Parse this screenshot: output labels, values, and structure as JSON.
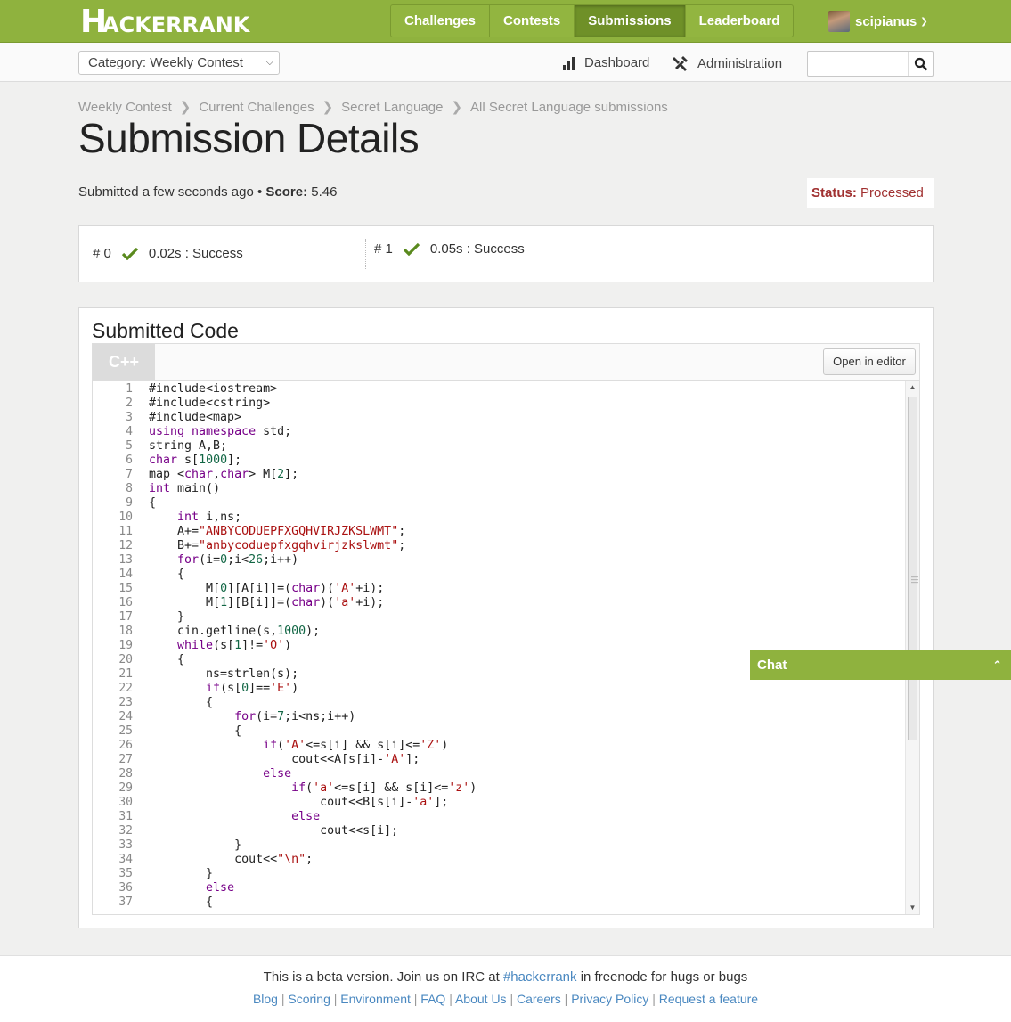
{
  "nav": {
    "logo": "HACKERRANK",
    "tabs": [
      "Challenges",
      "Contests",
      "Submissions",
      "Leaderboard"
    ],
    "active_tab": "Submissions",
    "username": "scipianus"
  },
  "subnav": {
    "category": "Category: Weekly Contest",
    "dashboard": "Dashboard",
    "administration": "Administration",
    "search_placeholder": ""
  },
  "breadcrumb": [
    "Weekly Contest",
    "Current Challenges",
    "Secret Language",
    "All Secret Language submissions"
  ],
  "page_title": "Submission Details",
  "meta": {
    "submitted": "Submitted a few seconds ago",
    "bullet": "•",
    "score_label": "Score:",
    "score_value": "5.46",
    "status_label": "Status:",
    "status_value": "Processed"
  },
  "tests": [
    {
      "id": "# 0",
      "result": "0.02s : Success"
    },
    {
      "id": "# 1",
      "result": "0.05s : Success"
    }
  ],
  "code": {
    "title": "Submitted Code",
    "language": "C++",
    "open_editor": "Open in editor",
    "lines": [
      "#include<iostream>",
      "#include<cstring>",
      "#include<map>",
      "using namespace std;",
      "string A,B;",
      "char s[1000];",
      "map <char,char> M[2];",
      "int main()",
      "{",
      "    int i,ns;",
      "    A+=\"ANBYCODUEPFXGQHVIRJZKSLWMT\";",
      "    B+=\"anbycoduepfxgqhvirjzkslwmt\";",
      "    for(i=0;i<26;i++)",
      "    {",
      "        M[0][A[i]]=(char)('A'+i);",
      "        M[1][B[i]]=(char)('a'+i);",
      "    }",
      "    cin.getline(s,1000);",
      "    while(s[1]!='O')",
      "    {",
      "        ns=strlen(s);",
      "        if(s[0]=='E')",
      "        {",
      "            for(i=7;i<ns;i++)",
      "            {",
      "                if('A'<=s[i] && s[i]<='Z')",
      "                    cout<<A[s[i]-'A'];",
      "                else",
      "                    if('a'<=s[i] && s[i]<='z')",
      "                        cout<<B[s[i]-'a'];",
      "                    else",
      "                        cout<<s[i];",
      "            }",
      "            cout<<\"\\n\";",
      "        }",
      "        else",
      "        {"
    ]
  },
  "chat": {
    "label": "Chat"
  },
  "footer": {
    "line_prefix": "This is a beta version. Join us on IRC at",
    "irc_link": "#hackerrank",
    "line_suffix": "in freenode for hugs or bugs",
    "links": [
      "Blog",
      "Scoring",
      "Environment",
      "FAQ",
      "About Us",
      "Careers",
      "Privacy Policy",
      "Request a feature"
    ]
  },
  "colors": {
    "brand_green": "#8fb23e",
    "status_red": "#a03030",
    "success_check": "#5a8a1e",
    "link_blue": "#4a88c0"
  }
}
